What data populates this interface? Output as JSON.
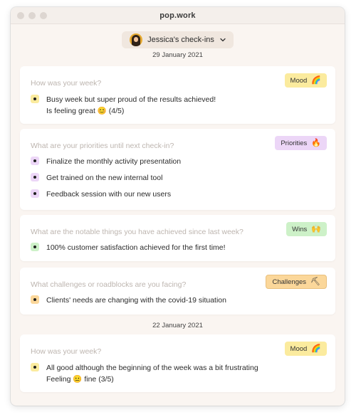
{
  "window": {
    "title": "pop.work"
  },
  "selector": {
    "label": "Jessica's check-ins"
  },
  "dates": [
    "29 January 2021",
    "22 January 2021"
  ],
  "cards": [
    {
      "question": "How was your week?",
      "tag": {
        "label": "Mood",
        "emoji": "🌈"
      },
      "items": [
        {
          "lines": [
            "Busy week but super proud of the results achieved!",
            "Is feeling great 😊 (4/5)"
          ]
        }
      ]
    },
    {
      "question": "What are your priorities until next check-in?",
      "tag": {
        "label": "Priorities",
        "emoji": "🔥"
      },
      "items": [
        {
          "lines": [
            "Finalize the monthly activity presentation"
          ]
        },
        {
          "lines": [
            "Get trained on the new internal tool"
          ]
        },
        {
          "lines": [
            "Feedback session with our new users"
          ]
        }
      ]
    },
    {
      "question": "What are the notable things you have achieved since last week?",
      "tag": {
        "label": "Wins",
        "emoji": "🙌"
      },
      "items": [
        {
          "lines": [
            "100% customer satisfaction achieved for the first time!"
          ]
        }
      ]
    },
    {
      "question": "What challenges or roadblocks are you facing?",
      "tag": {
        "label": "Challenges",
        "emoji": "⛏"
      },
      "items": [
        {
          "lines": [
            "Clients' needs are changing with the covid-19 situation"
          ]
        }
      ]
    },
    {
      "question": "How was your week?",
      "tag": {
        "label": "Mood",
        "emoji": "🌈"
      },
      "items": [
        {
          "lines": [
            "All good although the beginning of the week was a bit frustrating",
            "Feeling 😐 fine (3/5)"
          ]
        }
      ]
    }
  ],
  "colors": {
    "mood": "#fbeb9e",
    "priorities": "#ecd6f7",
    "wins": "#cdf1c8",
    "challenges": "#fbd79a",
    "background": "#faf5f1"
  },
  "icons": {
    "selector_chevron": "chevron-down-icon",
    "avatar": "avatar"
  }
}
